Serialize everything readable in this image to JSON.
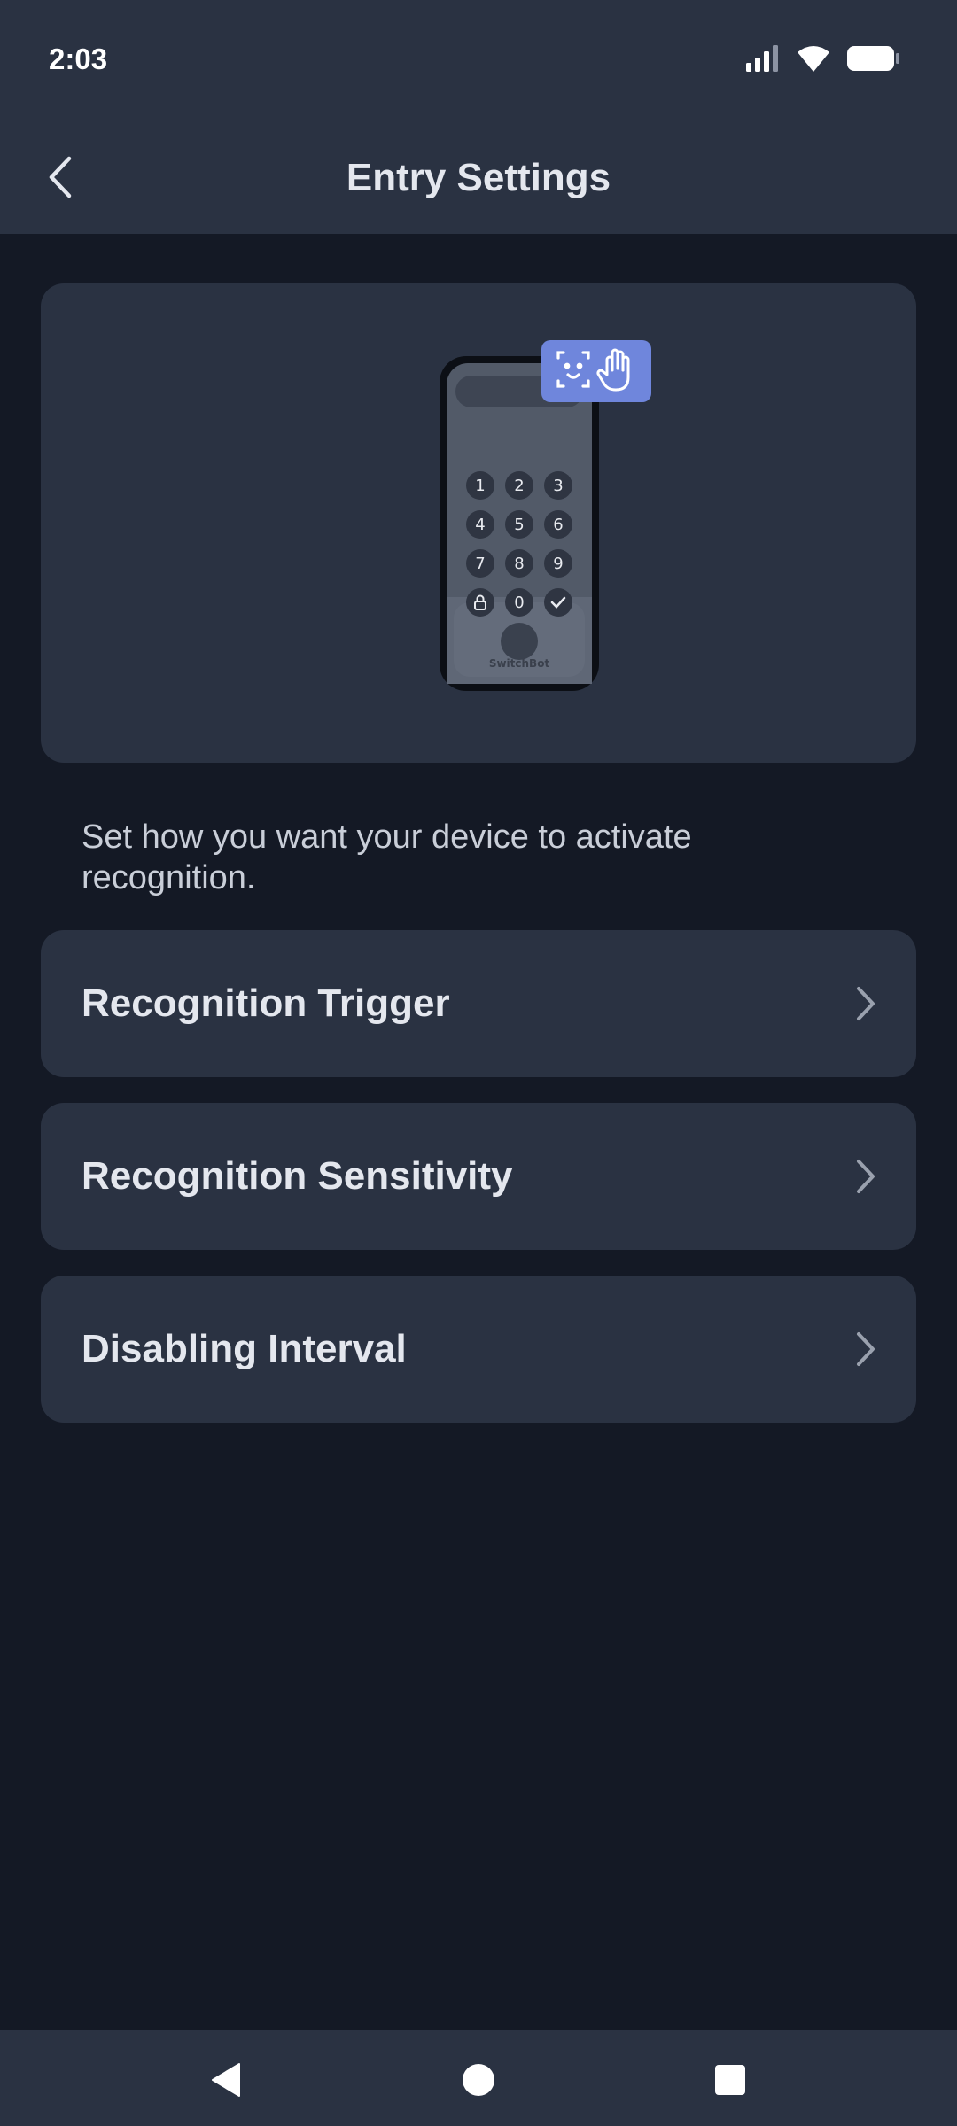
{
  "status_bar": {
    "time": "2:03",
    "icons": [
      "signal-icon",
      "wifi-icon",
      "battery-icon"
    ]
  },
  "header": {
    "title": "Entry Settings",
    "back_icon": "chevron-left-icon"
  },
  "hero": {
    "keypad_keys": [
      "1",
      "2",
      "3",
      "4",
      "5",
      "6",
      "7",
      "8",
      "9",
      "lock",
      "0",
      "check"
    ],
    "brand_text": "SwitchBot",
    "badge_icons": [
      "face-scan-icon",
      "hand-icon"
    ],
    "badge_color": "#6f86dc"
  },
  "description": "Set how you want your device to activate recognition.",
  "menu": {
    "items": [
      {
        "label": "Recognition Trigger"
      },
      {
        "label": "Recognition Sensitivity"
      },
      {
        "label": "Disabling Interval"
      }
    ]
  },
  "nav_bar": {
    "buttons": [
      "back-nav-icon",
      "home-nav-icon",
      "recents-nav-icon"
    ]
  },
  "colors": {
    "background": "#141925",
    "surface": "#2a3242",
    "text_primary": "#e4e7ee",
    "text_secondary": "#c9ced8"
  }
}
